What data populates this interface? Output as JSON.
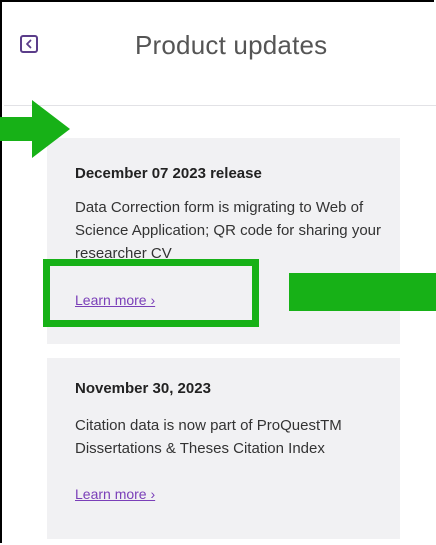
{
  "header": {
    "title": "Product updates",
    "back_icon": "chevron-left-icon"
  },
  "updates": [
    {
      "title": "December 07 2023 release",
      "body": "Data Correction form is migrating to Web of Science Application; QR code for sharing your researcher CV",
      "link": "Learn more ›"
    },
    {
      "title": "November 30, 2023",
      "body": "Citation data is now part of ProQuestTM Dissertations & Theses Citation Index",
      "link": "Learn more ›"
    }
  ],
  "colors": {
    "accent": "#7a3fb8",
    "highlight": "#17b117",
    "card_bg": "#f1f1f3",
    "title_text": "#555555"
  }
}
